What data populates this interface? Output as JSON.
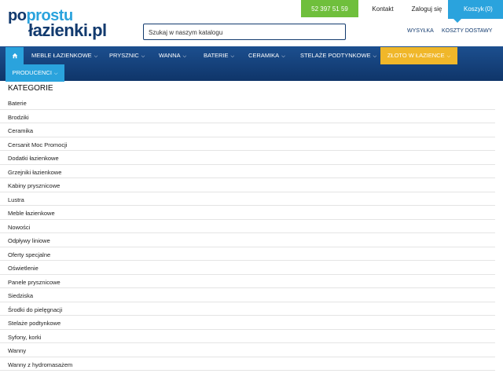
{
  "brand": {
    "logo_line1_a": "po",
    "logo_line1_b": "prostu",
    "logo_line2": "łazienki.pl"
  },
  "header": {
    "search_placeholder": "Szukaj w naszym katalogu",
    "phone": "52 397 51 59",
    "contact": "Kontakt",
    "login": "Zaloguj się",
    "cart_label": "Koszyk",
    "cart_count": "(0)",
    "shipping": "WYSYŁKA",
    "shipping_costs": "KOSZTY DOSTAWY"
  },
  "nav": {
    "items": [
      "MEBLE ŁAZIENKOWE",
      "PRYSZNIC",
      "WANNA",
      "BATERIE",
      "CERAMIKA",
      "STELAŻE PODTYNKOWE"
    ],
    "gold": "ZŁOTO W ŁAZIENCE",
    "producers": "PRODUCENCI"
  },
  "categories": {
    "heading": "KATEGORIE",
    "items": [
      "Baterie",
      "Brodziki",
      "Ceramika",
      "Cersanit Moc Promocji",
      "Dodatki łazienkowe",
      "Grzejniki łazienkowe",
      "Kabiny prysznicowe",
      "Lustra",
      "Meble łazienkowe",
      "Nowości",
      "Odpływy liniowe",
      "Oferty specjalne",
      "Oświetlenie",
      "Panele prysznicowe",
      "Siedziska",
      "Środki do pielęgnacji",
      "Stelaże podtynkowe",
      "Syfony, korki",
      "Wanny",
      "Wanny z hydromasażem"
    ]
  }
}
